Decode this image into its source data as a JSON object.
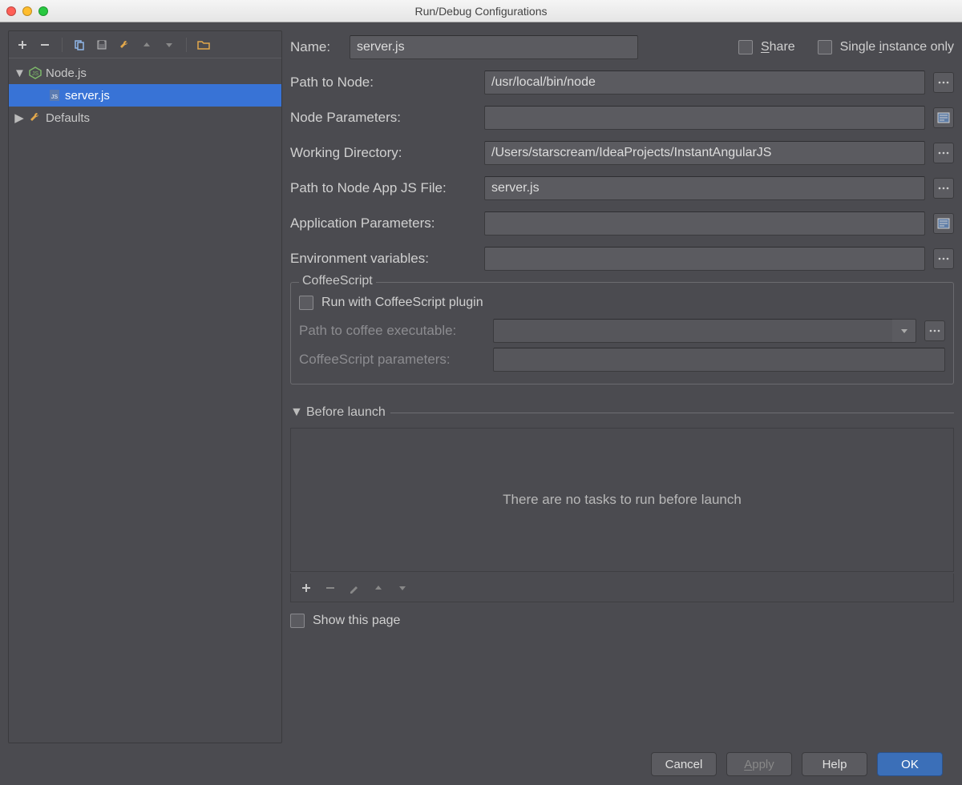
{
  "window": {
    "title": "Run/Debug Configurations"
  },
  "sidebar": {
    "items": [
      {
        "label": "Node.js",
        "expanded": true,
        "type": "node"
      },
      {
        "label": "server.js",
        "selected": true,
        "type": "js",
        "indent": 1
      },
      {
        "label": "Defaults",
        "expanded": false,
        "type": "folder"
      }
    ]
  },
  "form": {
    "name_label": "Name:",
    "name_value": "server.js",
    "share_label": "Share",
    "single_instance_label": "Single instance only",
    "path_to_node_label": "Path to Node:",
    "path_to_node_value": "/usr/local/bin/node",
    "node_parameters_label": "Node Parameters:",
    "node_parameters_value": "",
    "working_dir_label": "Working Directory:",
    "working_dir_value": "/Users/starscream/IdeaProjects/InstantAngularJS",
    "app_js_label": "Path to Node App JS File:",
    "app_js_value": "server.js",
    "app_params_label": "Application Parameters:",
    "app_params_value": "",
    "env_vars_label": "Environment variables:",
    "env_vars_value": ""
  },
  "coffee": {
    "group_title": "CoffeeScript",
    "run_with_label": "Run with CoffeeScript plugin",
    "path_label": "Path to coffee executable:",
    "path_value": "",
    "params_label": "CoffeeScript parameters:",
    "params_value": ""
  },
  "before_launch": {
    "header": "Before launch",
    "empty_text": "There are no tasks to run before launch",
    "show_page_label": "Show this page"
  },
  "footer": {
    "cancel": "Cancel",
    "apply": "Apply",
    "help": "Help",
    "ok": "OK"
  }
}
